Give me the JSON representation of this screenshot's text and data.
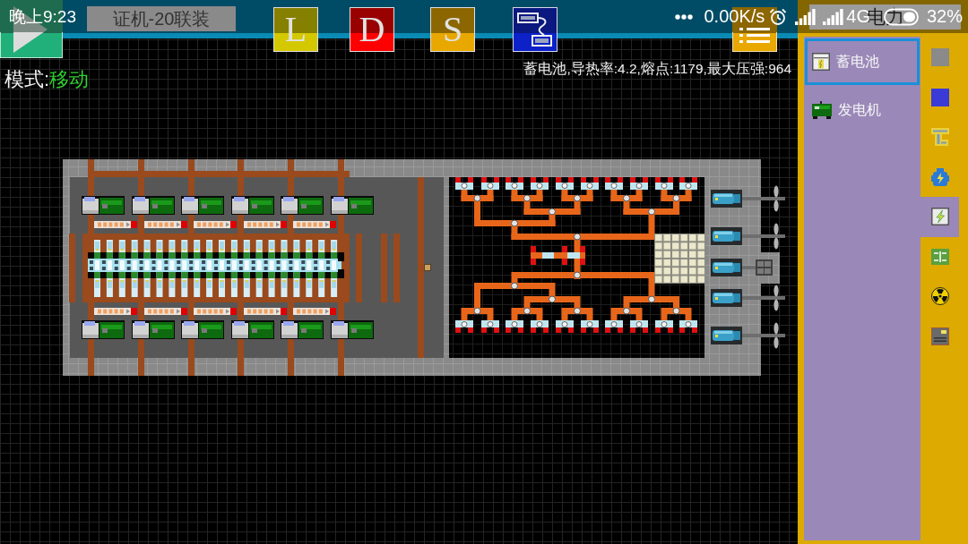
{
  "status_bar": {
    "time": "晚上9:23",
    "speed": "0.00K/s",
    "network": "4G",
    "battery": "32%"
  },
  "toolbar": {
    "title": "证机-20联装",
    "buttons": [
      {
        "label": "L"
      },
      {
        "label": "D"
      },
      {
        "label": "S"
      }
    ]
  },
  "hud": {
    "mode_label": "模式:",
    "mode_value": "移动",
    "info": "蓄电池,导热率:4.2,熔点:1179,最大压强:964"
  },
  "panel": {
    "title": "电力",
    "items": [
      {
        "label": "蓄电池",
        "kind": "battery",
        "selected": true
      },
      {
        "label": "发电机",
        "kind": "generator",
        "selected": false
      }
    ],
    "categories": [
      {
        "kind": "block",
        "selected": false
      },
      {
        "kind": "tile",
        "selected": false
      },
      {
        "kind": "pipe",
        "selected": false
      },
      {
        "kind": "engine",
        "selected": false
      },
      {
        "kind": "power",
        "selected": true
      },
      {
        "kind": "circuit",
        "selected": false
      },
      {
        "kind": "radiation",
        "selected": false
      },
      {
        "kind": "computer",
        "selected": false
      }
    ]
  }
}
